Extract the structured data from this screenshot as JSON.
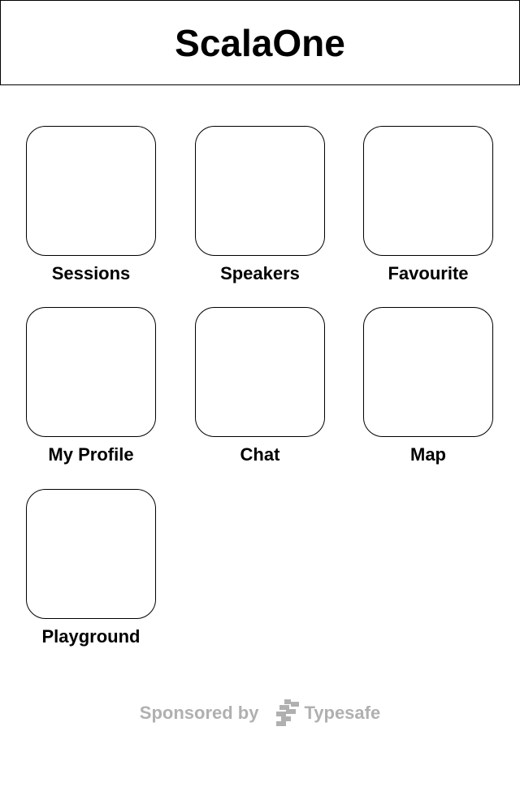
{
  "header": {
    "title": "ScalaOne"
  },
  "menu": {
    "items": [
      {
        "label": "Sessions"
      },
      {
        "label": "Speakers"
      },
      {
        "label": "Favourite"
      },
      {
        "label": "My Profile"
      },
      {
        "label": "Chat"
      },
      {
        "label": "Map"
      },
      {
        "label": "Playground"
      }
    ]
  },
  "footer": {
    "sponsored_by": "Sponsored by",
    "sponsor_name": "Typesafe",
    "sponsor_icon": "typesafe-logo-icon",
    "text_color": "#b0b0b0"
  }
}
